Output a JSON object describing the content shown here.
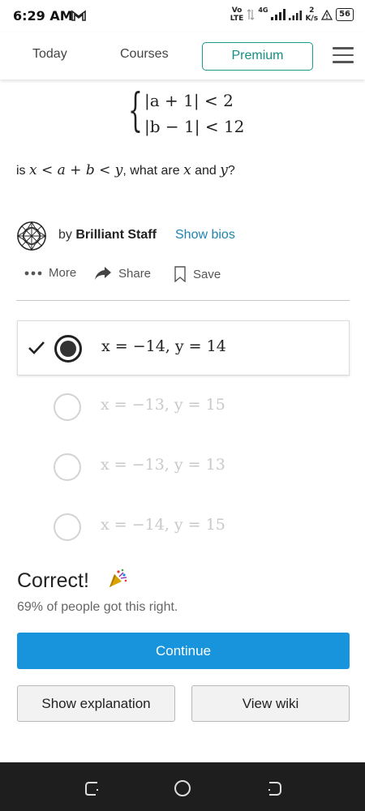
{
  "status_bar": {
    "time": "6:29 AM",
    "volte_top": "Vo",
    "volte_bottom": "LTE",
    "network": "4G",
    "speed_top": "2",
    "speed_bottom": "K/s",
    "battery": "56"
  },
  "nav": {
    "today": "Today",
    "courses": "Courses",
    "premium": "Premium",
    "accent_color": "#1a9a8c"
  },
  "problem": {
    "inequality_1": "|a + 1| < 2",
    "inequality_2": "|b − 1| < 12",
    "question_prefix": "is ",
    "question_math": "x < a + b < y",
    "question_middle": ", what are ",
    "question_x": "x",
    "question_and": " and ",
    "question_y": "y",
    "question_end": "?"
  },
  "author": {
    "by": "by ",
    "name": "Brilliant Staff",
    "bios_link": "Show bios"
  },
  "actions": {
    "more": "More",
    "share": "Share",
    "save": "Save"
  },
  "options": [
    {
      "label": "x = −14, y = 14",
      "selected": true
    },
    {
      "label": "x = −13, y = 15",
      "selected": false
    },
    {
      "label": "x = −13, y = 13",
      "selected": false
    },
    {
      "label": "x = −14, y = 15",
      "selected": false
    }
  ],
  "result": {
    "title": "Correct!",
    "stat": "69% of people got this right."
  },
  "buttons": {
    "continue": "Continue",
    "show_explanation": "Show explanation",
    "view_wiki": "View wiki",
    "primary_color": "#1894dc"
  }
}
